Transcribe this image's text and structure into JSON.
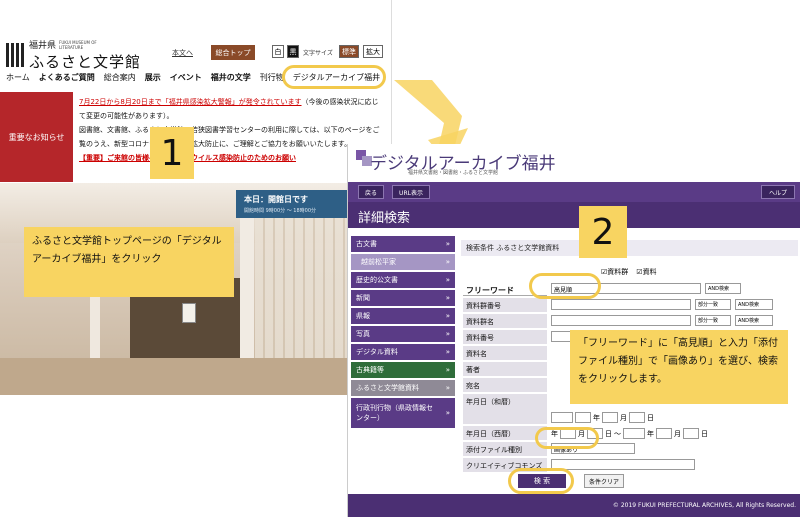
{
  "left": {
    "logo": {
      "pref": "福井県",
      "en": "FUKUI MUSEUM OF LITERATURE",
      "name": "ふるさと文学館"
    },
    "header": {
      "link_text": "本文へ",
      "main_top_btn": "総合トップ",
      "fs_white": "白",
      "fs_black": "黒",
      "fs_label": "文字サイズ",
      "size_std": "標準",
      "size_big": "拡大"
    },
    "nav": [
      "ホーム",
      "よくあるご質問",
      "総合案内",
      "展示",
      "イベント",
      "福井の文学",
      "刊行物",
      "デジタルアーカイブ福井"
    ],
    "notice": {
      "title": "重要なお知らせ",
      "line1a": "7月22日から8月20日まで「福井県感染拡大警報」が発令されています",
      "line1b": "（今後の感染状況に応じて変更の可能性があります）。",
      "line2": "図書館、文書館、ふるさと文学館、若狭図書学習センターの利用に際しては、以下のページをご覧のうえ、新型コロナウイルス感染拡大防止に、ご理解とご協力をお願いいたします。",
      "link": "【重要】ご来館の皆様へ新型コロナウイルス感染防止のためのお願い"
    },
    "open": {
      "title": "本日：開館日です",
      "hours": "開館時間 9時00分 ～ 18時00分"
    },
    "note": "ふるさと文学館トップページの「デジタルアーカイブ福井」をクリック",
    "badge": "1"
  },
  "right": {
    "title": "デジタルアーカイブ福井",
    "subtitle": "福井県文書館・図書館・ふるさと文学館",
    "btn_back": "戻る",
    "btn_url": "URL表示",
    "btn_help": "ヘルプ",
    "heading": "詳細検索",
    "side": [
      "古文書",
      "越前松平家",
      "歴史的公文書",
      "新聞",
      "県報",
      "写真",
      "デジタル資料",
      "古典籍等",
      "ふるさと文学館資料",
      "行政刊行物（県政情報センター）"
    ],
    "form_title": "検索条件 ふるさと文学館資料",
    "check1": "資料群",
    "check2": "資料",
    "free_word_label": "フリーワード",
    "free_word_value": "高見順",
    "op_and": "AND検索",
    "op_partial": "部分一致",
    "labels": [
      "資料群番号",
      "資料群名",
      "資料番号",
      "資料名",
      "著者",
      "宛名",
      "年月日（和暦）",
      "年月日（西暦）",
      "添付ファイル種別",
      "クリエイティブコモンズ"
    ],
    "year": "年",
    "month": "月",
    "day": "日",
    "tilde": "～",
    "attach_value": "画像あり",
    "search_btn": "検 索",
    "clear_btn": "条件クリア",
    "footer": "© 2019 FUKUI PREFECTURAL ARCHIVES, All Rights Reserved.",
    "note": "「フリーワード」に「高見順」と入力「添付ファイル種別」で「画像あり」を選び、検索をクリックします。",
    "badge": "2"
  },
  "colors": {
    "accent_yellow": "#f8d461",
    "archive_purple": "#4b2f73",
    "notice_red": "#b5262a"
  }
}
